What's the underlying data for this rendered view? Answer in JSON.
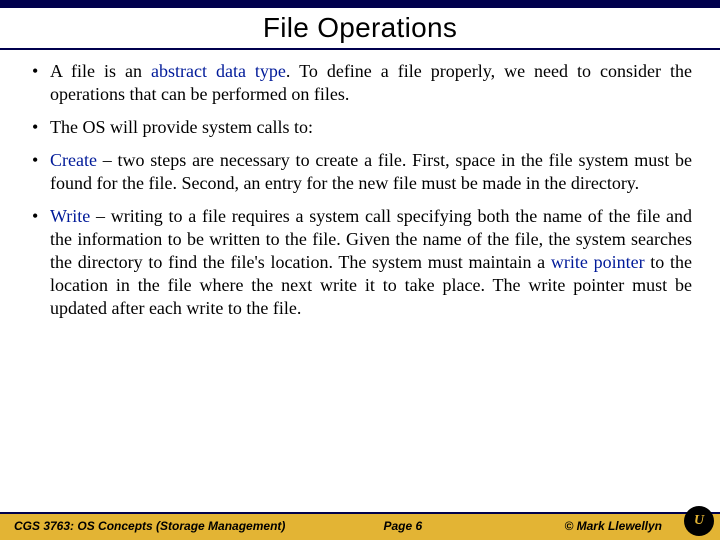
{
  "title": "File Operations",
  "bullets": {
    "b1a": "A file is an ",
    "b1kw": "abstract data type",
    "b1b": ".  To define a file properly, we need to consider the operations that can be performed on files.",
    "b2": "The OS will provide system calls to:",
    "b3kw": "Create",
    "b3": " – two steps are necessary to create a file.  First, space in the file system must be found for the file.  Second, an entry for the new file must be made in the directory.",
    "b4kw": "Write",
    "b4a": " – writing to a file requires a system call specifying both the name of the file and the information to be written to the file.  Given the name of the file, the system searches the directory to find the file's location.  The system must maintain a ",
    "b4kw2": "write pointer",
    "b4b": " to the location in the file where the next write it to take place.  The write pointer must be updated after each write to the file."
  },
  "footer": {
    "course": "CGS 3763: OS Concepts  (Storage Management)",
    "page": "Page 6",
    "author": "© Mark Llewellyn"
  },
  "logo_text": "U"
}
